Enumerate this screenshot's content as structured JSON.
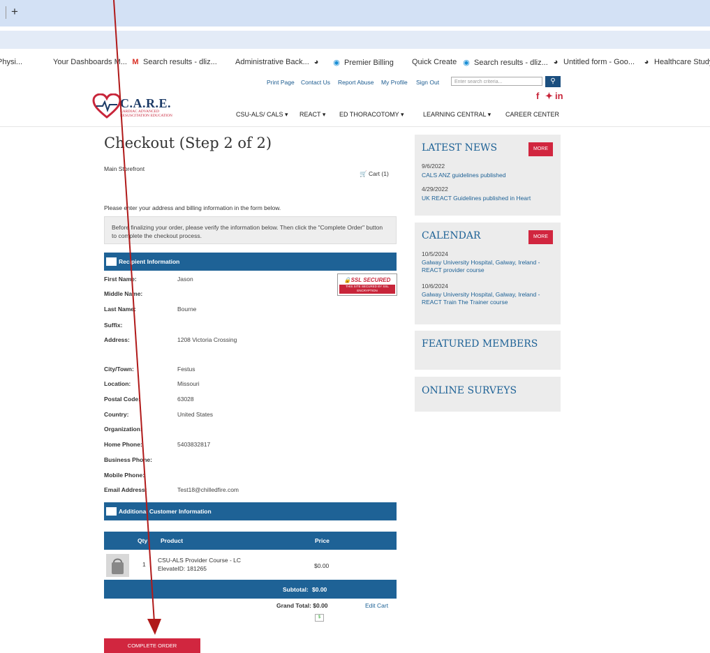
{
  "browser": {
    "new_tab": "+",
    "bookmarks": [
      {
        "label": "Physi...",
        "icon": "none"
      },
      {
        "label": "Your Dashboards M...",
        "icon": "none"
      },
      {
        "label": "Search results - dliz...",
        "icon": "gmail-icon"
      },
      {
        "label": "Administrative Back...",
        "icon": "none"
      },
      {
        "label": "",
        "icon": "globe-icon"
      },
      {
        "label": "Premier Billing",
        "icon": "att-icon"
      },
      {
        "label": "Quick Create",
        "icon": "none"
      },
      {
        "label": "Search results - dliz...",
        "icon": "att-icon"
      },
      {
        "label": "Untitled form - Goo...",
        "icon": "globe-icon"
      },
      {
        "label": "Healthcare Study",
        "icon": "globe-icon"
      }
    ]
  },
  "header": {
    "toplinks": [
      "Print Page",
      "Contact Us",
      "Report Abuse",
      "My Profile",
      "Sign Out"
    ],
    "search_placeholder": "Enter search criteria...",
    "logo_title": "C.A.R.E.",
    "logo_subtitle": "CARDIAC ADVANCED RESUSCITATION EDUCATION",
    "nav": [
      "CSU-ALS/ CALS ▾",
      "REACT ▾",
      "ED THORACOTOMY ▾",
      "LEARNING CENTRAL ▾",
      "CAREER CENTER"
    ]
  },
  "checkout": {
    "title": "Checkout (Step 2 of 2)",
    "storefront": "Main Storefront",
    "cart": "Cart (1)",
    "intro": "Please enter your address and billing information in the form below.",
    "note": "Before finalizing your order, please verify the information below. Then click the \"Complete Order\" button to complete the checkout process.",
    "recipient_header": "Recipient Information",
    "ssl_title": "SSL SECURED",
    "ssl_sub": "THIS SITE SECURED BY SSL ENCRYPTION",
    "fields": [
      {
        "label": "First Name:",
        "value": "Jason"
      },
      {
        "label": "Middle Name:",
        "value": ""
      },
      {
        "label": "Last Name:",
        "value": "Bourne"
      },
      {
        "label": "Suffix:",
        "value": ""
      },
      {
        "label": "Address:",
        "value": "1208 Victoria Crossing"
      },
      {
        "label": "City/Town:",
        "value": "Festus"
      },
      {
        "label": "Location:",
        "value": "Missouri"
      },
      {
        "label": "Postal Code:",
        "value": "63028"
      },
      {
        "label": "Country:",
        "value": "United States"
      },
      {
        "label": "Organization:",
        "value": ""
      },
      {
        "label": "Home Phone:",
        "value": "5403832817"
      },
      {
        "label": "Business Phone:",
        "value": ""
      },
      {
        "label": "Mobile Phone:",
        "value": ""
      },
      {
        "label": "Email Address:",
        "value": "Test18@chilledfire.com"
      }
    ],
    "additional_header": "Additional Customer Information",
    "table_headers": {
      "qty": "Qty",
      "product": "Product",
      "price": "Price"
    },
    "item": {
      "qty": "1",
      "product_line1": "CSU-ALS Provider Course - LC",
      "product_line2": "ElevateID: 181265",
      "price": "$0.00"
    },
    "subtotal_label": "Subtotal:",
    "subtotal_value": "$0.00",
    "grand_total": "Grand Total: $0.00",
    "edit_cart": "Edit Cart",
    "complete_button": "COMPLETE ORDER"
  },
  "sidebar": {
    "latest_news": {
      "title": "LATEST NEWS",
      "more": "MORE",
      "items": [
        {
          "date": "9/6/2022",
          "text": "CALS ANZ guidelines published"
        },
        {
          "date": "4/29/2022",
          "text": "UK REACT Guidelines published in Heart"
        }
      ]
    },
    "calendar": {
      "title": "CALENDAR",
      "more": "MORE",
      "items": [
        {
          "date": "10/5/2024",
          "text": "Galway University Hospital, Galway, Ireland - REACT provider course"
        },
        {
          "date": "10/6/2024",
          "text": "Galway University Hospital, Galway, Ireland - REACT Train The Trainer course"
        }
      ]
    },
    "featured_members": "FEATURED MEMBERS",
    "online_surveys": "ONLINE SURVEYS"
  },
  "colors": {
    "brand_blue": "#1e6296",
    "accent_red": "#d1263f",
    "annotation_arrow": "#b01a1a"
  }
}
